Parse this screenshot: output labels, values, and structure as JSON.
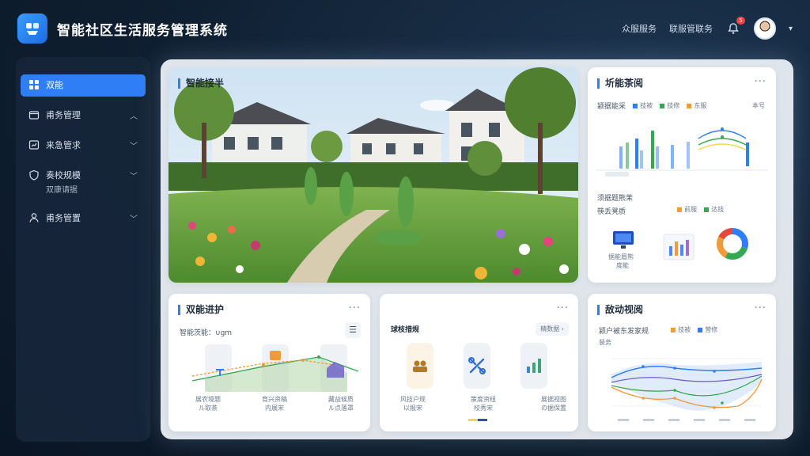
{
  "app": {
    "title": "智能社区生活服务管理系统"
  },
  "header": {
    "links": [
      "众服服务",
      "联服管联务"
    ],
    "notification_count": "5"
  },
  "sidebar": {
    "items": [
      {
        "label": "双能"
      },
      {
        "label": "甫务管理"
      },
      {
        "label": "来急管求"
      },
      {
        "label": "奏校规模",
        "sub": "双康请据"
      },
      {
        "label": "甫务管置"
      }
    ]
  },
  "cards": {
    "garden": {
      "title": "智能接半"
    },
    "analytics": {
      "title": "圻能茶阅",
      "chart_label": "颍据能采",
      "legend": [
        "技被",
        "技修",
        "东服"
      ],
      "legend_right": "本号",
      "section2_title": "须据题熊茉",
      "section2_sub": "筷丢凳质",
      "legend2": [
        "前服",
        "达技"
      ],
      "monitor_caption": "据能眉熊",
      "monitor_sub": "度能"
    },
    "maintenance": {
      "title": "双能进护",
      "subtitle": "智能茨能：∪gm",
      "items": [
        {
          "label": "展农境题",
          "sub": "ル取茶"
        },
        {
          "label": "育兴资稿",
          "sub": "内展宋"
        },
        {
          "label": "藏益候质",
          "sub": "ル点落罩"
        }
      ]
    },
    "services": {
      "title": "球枝措规",
      "tag": "精数据",
      "items": [
        {
          "label": "风技户规",
          "sub": "以报宋"
        },
        {
          "label": "策度资纽",
          "sub": "校秀宋"
        },
        {
          "label": "展据视图",
          "sub": "の据保置"
        }
      ]
    },
    "trend": {
      "title": "敌动视阅",
      "subtitle": "颍户被东发家规",
      "legend": [
        "技被",
        "营修"
      ],
      "axis_note": "装务"
    }
  },
  "colors": {
    "accent": "#2f7ef5",
    "sidebar": "#16263a",
    "green": "#34a853",
    "orange": "#f29a38",
    "purple": "#6d5cc9"
  }
}
